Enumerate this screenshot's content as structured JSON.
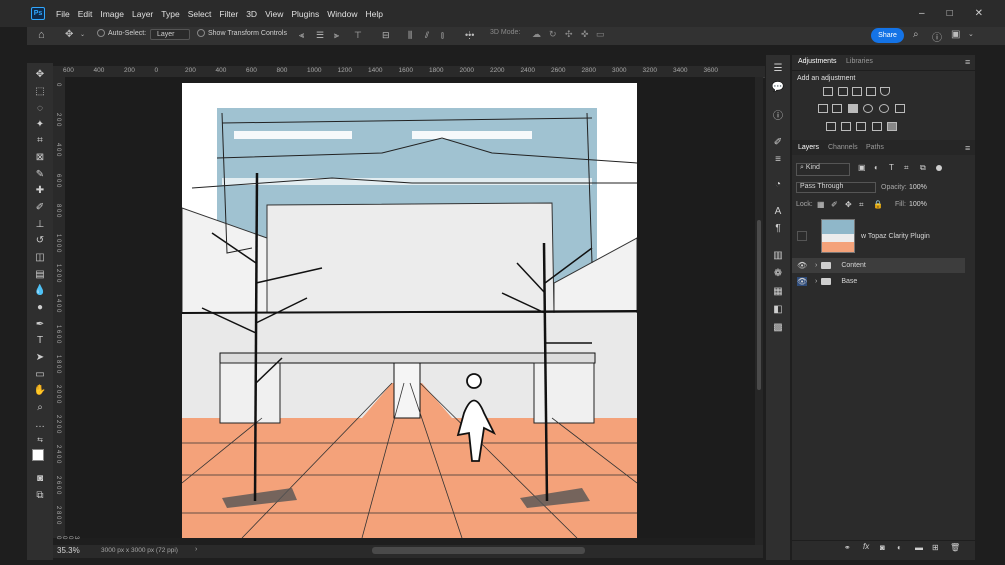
{
  "app": {
    "logo": "Ps"
  },
  "menu": [
    "File",
    "Edit",
    "Image",
    "Layer",
    "Type",
    "Select",
    "Filter",
    "3D",
    "View",
    "Plugins",
    "Window",
    "Help"
  ],
  "window_controls": {
    "minimize": "–",
    "maximize": "□",
    "close": "✕"
  },
  "options_bar": {
    "auto_select_label": "Auto-Select:",
    "auto_select_target": "Layer",
    "show_transform_label": "Show Transform Controls",
    "mode_3d_label": "3D Mode:",
    "more": "•••",
    "share_label": "Share"
  },
  "ruler": {
    "h_labels": [
      "600",
      "400",
      "200",
      "0",
      "200",
      "400",
      "600",
      "800",
      "1000",
      "1200",
      "1400",
      "1600",
      "1800",
      "2000",
      "2200",
      "2400",
      "2600",
      "2800",
      "3000",
      "3200",
      "3400",
      "3600"
    ],
    "v_labels": [
      "0",
      "2 0 0",
      "4 0 0",
      "6 0 0",
      "8 0 0",
      "1 0 0 0",
      "1 2 0 0",
      "1 4 0 0",
      "1 6 0 0",
      "1 8 0 0",
      "2 0 0 0",
      "2 2 0 0",
      "2 4 0 0",
      "2 6 0 0",
      "2 8 0 0",
      "3 0 0 0"
    ]
  },
  "status": {
    "zoom": "35.3%",
    "doc_info": "3000 px x 3000 px (72 ppi)"
  },
  "adjustments_panel": {
    "tabs": [
      "Adjustments",
      "Libraries"
    ],
    "active_tab": "Adjustments",
    "add_label": "Add an adjustment"
  },
  "layers_panel": {
    "tabs": [
      "Layers",
      "Channels",
      "Paths"
    ],
    "active_tab": "Layers",
    "filter_kind": "Kind",
    "blend_mode": "Pass Through",
    "opacity_label": "Opacity:",
    "opacity_value": "100%",
    "lock_label": "Lock:",
    "fill_label": "Fill:",
    "fill_value": "100%",
    "layers": [
      {
        "name": "w Topaz Clarity Plugin",
        "visible": false,
        "type": "image"
      },
      {
        "name": "Content",
        "visible": true,
        "type": "group",
        "selected": true
      },
      {
        "name": "Base",
        "visible": true,
        "type": "group"
      }
    ]
  },
  "colors": {
    "accent": "#1473e6",
    "background": "#1e1e1e",
    "panel": "#2b2b2b",
    "sky_wash": "#8fb7c9",
    "floor_wash": "#f4a27a"
  }
}
